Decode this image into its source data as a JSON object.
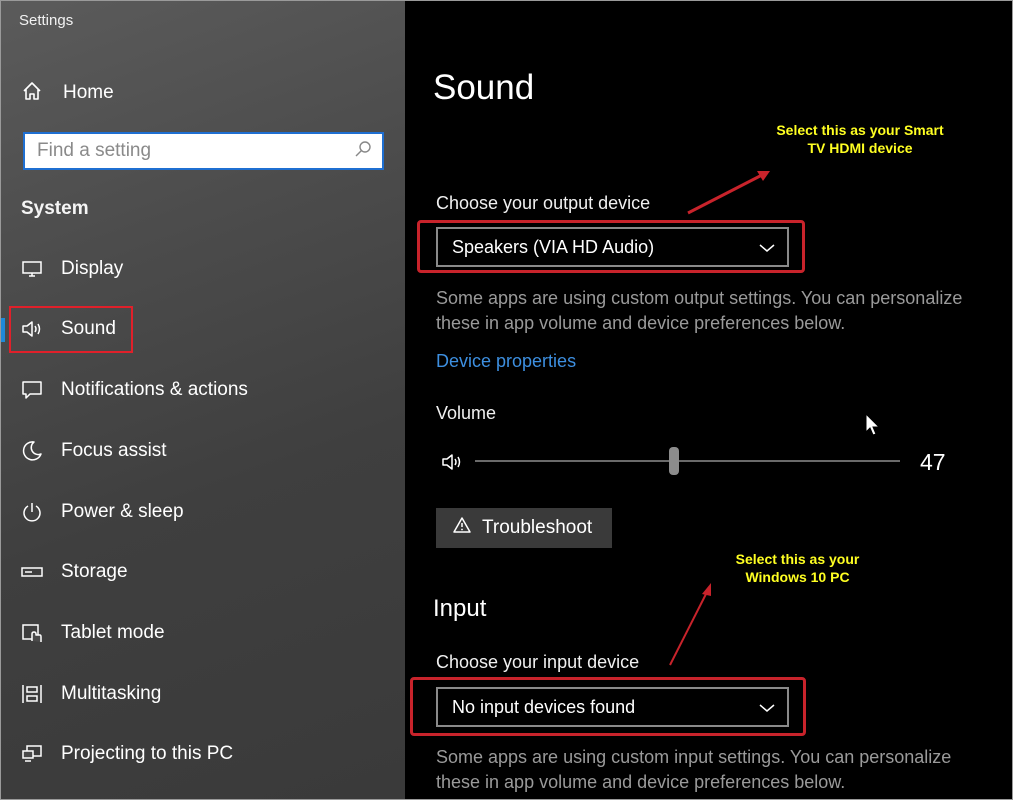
{
  "window": {
    "title": "Settings"
  },
  "sidebar": {
    "home_label": "Home",
    "search_placeholder": "Find a setting",
    "section": "System",
    "items": [
      {
        "label": "Display",
        "icon": "monitor-icon"
      },
      {
        "label": "Sound",
        "icon": "speaker-icon",
        "active": true
      },
      {
        "label": "Notifications & actions",
        "icon": "notification-icon"
      },
      {
        "label": "Focus assist",
        "icon": "moon-icon"
      },
      {
        "label": "Power & sleep",
        "icon": "power-icon"
      },
      {
        "label": "Storage",
        "icon": "storage-icon"
      },
      {
        "label": "Tablet mode",
        "icon": "tablet-mode-icon"
      },
      {
        "label": "Multitasking",
        "icon": "multitasking-icon"
      },
      {
        "label": "Projecting to this PC",
        "icon": "projecting-icon"
      }
    ]
  },
  "main": {
    "title": "Sound",
    "output": {
      "label": "Choose your output device",
      "selected": "Speakers (VIA HD Audio)",
      "description": "Some apps are using custom output settings. You can personalize these in app volume and device preferences below.",
      "device_properties_link": "Device properties"
    },
    "volume": {
      "label": "Volume",
      "value": 47,
      "value_text": "47"
    },
    "troubleshoot_label": "Troubleshoot",
    "input": {
      "heading": "Input",
      "label": "Choose your input device",
      "selected": "No input devices found",
      "description": "Some apps are using custom input settings. You can personalize these in app volume and device preferences below."
    }
  },
  "annotations": {
    "output_note_line1": "Select this as your Smart",
    "output_note_line2": "TV HDMI device",
    "input_note_line1": "Select this as your",
    "input_note_line2": "Windows 10  PC"
  },
  "colors": {
    "accent_blue": "#1f8ad8",
    "link_blue": "#3d8fe0",
    "highlight_red": "#c8232b",
    "annotation_yellow": "#ffff22"
  }
}
